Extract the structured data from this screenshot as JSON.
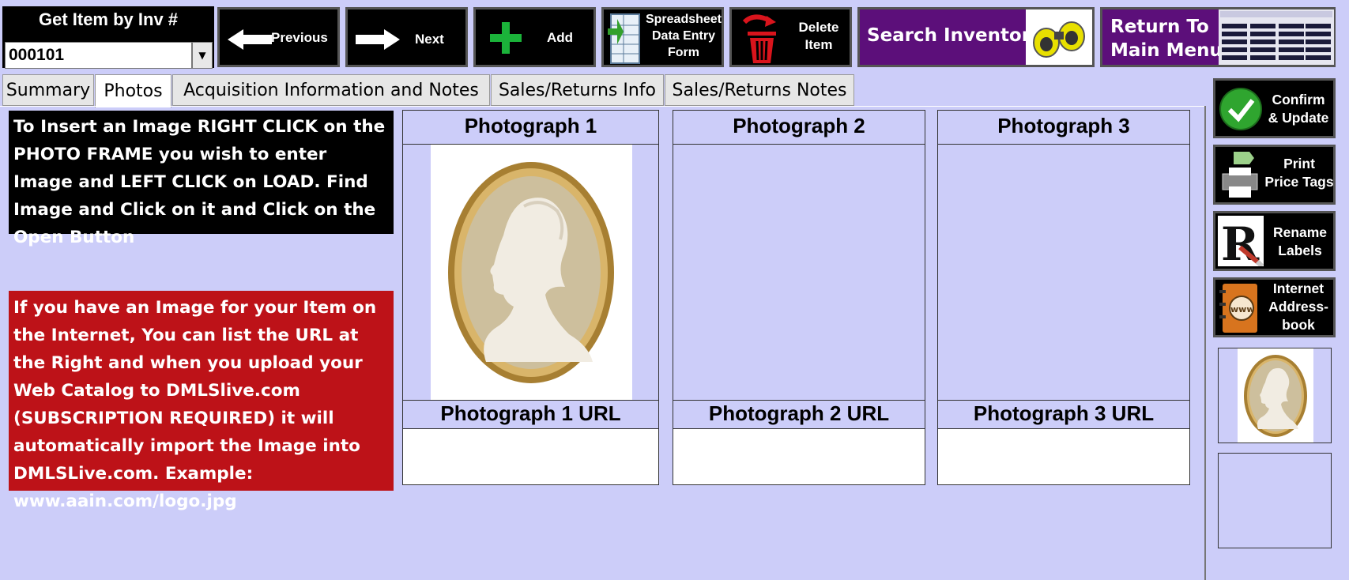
{
  "inventory": {
    "title": "Get Item by Inv #",
    "value": "000101"
  },
  "toolbar": {
    "previous": "Previous",
    "next": "Next",
    "add": "Add",
    "spreadsheet": [
      "Spreadsheet",
      "Data Entry",
      "Form"
    ],
    "delete": [
      "Delete",
      "Item"
    ],
    "search": "Search Inventory",
    "return": [
      "Return To",
      "Main Menu"
    ]
  },
  "tabs": [
    {
      "label": "Summary",
      "active": false
    },
    {
      "label": "Photos",
      "active": true
    },
    {
      "label": "Acquisition Information and Notes",
      "active": false
    },
    {
      "label": "Sales/Returns Info",
      "active": false
    },
    {
      "label": "Sales/Returns Notes",
      "active": false
    }
  ],
  "instructions": {
    "insert": "To Insert an Image RIGHT CLICK on the PHOTO FRAME you wish to enter Image and LEFT CLICK on LOAD. Find Image and Click on it and Click on the Open Button",
    "url": "If you have an Image for your Item on the Internet, You can list the URL at the Right and when you upload your Web Catalog to DMLSlive.com (SUBSCRIPTION REQUIRED) it will automatically import the Image into DMLSLive.com. Example: www.aain.com/logo.jpg"
  },
  "photos": [
    {
      "title": "Photograph 1",
      "url_title": "Photograph 1 URL",
      "url": ""
    },
    {
      "title": "Photograph 2",
      "url_title": "Photograph 2 URL",
      "url": ""
    },
    {
      "title": "Photograph 3",
      "url_title": "Photograph 3 URL",
      "url": ""
    }
  ],
  "side": {
    "confirm": [
      "Confirm",
      "& Update"
    ],
    "print": [
      "Print",
      "Price Tags"
    ],
    "rename": [
      "Rename",
      "Labels"
    ],
    "internet": [
      "Internet",
      "Address-",
      "book"
    ]
  },
  "colors": {
    "background": "#cccdf9",
    "toolbar_button": "#000000",
    "search_button": "#5c0f7a",
    "return_button": "#5c0f7a",
    "red_box": "#bd1218",
    "add_plus": "#1bb33a",
    "delete_red": "#d9141c",
    "confirm_green": "#2fa52f"
  }
}
